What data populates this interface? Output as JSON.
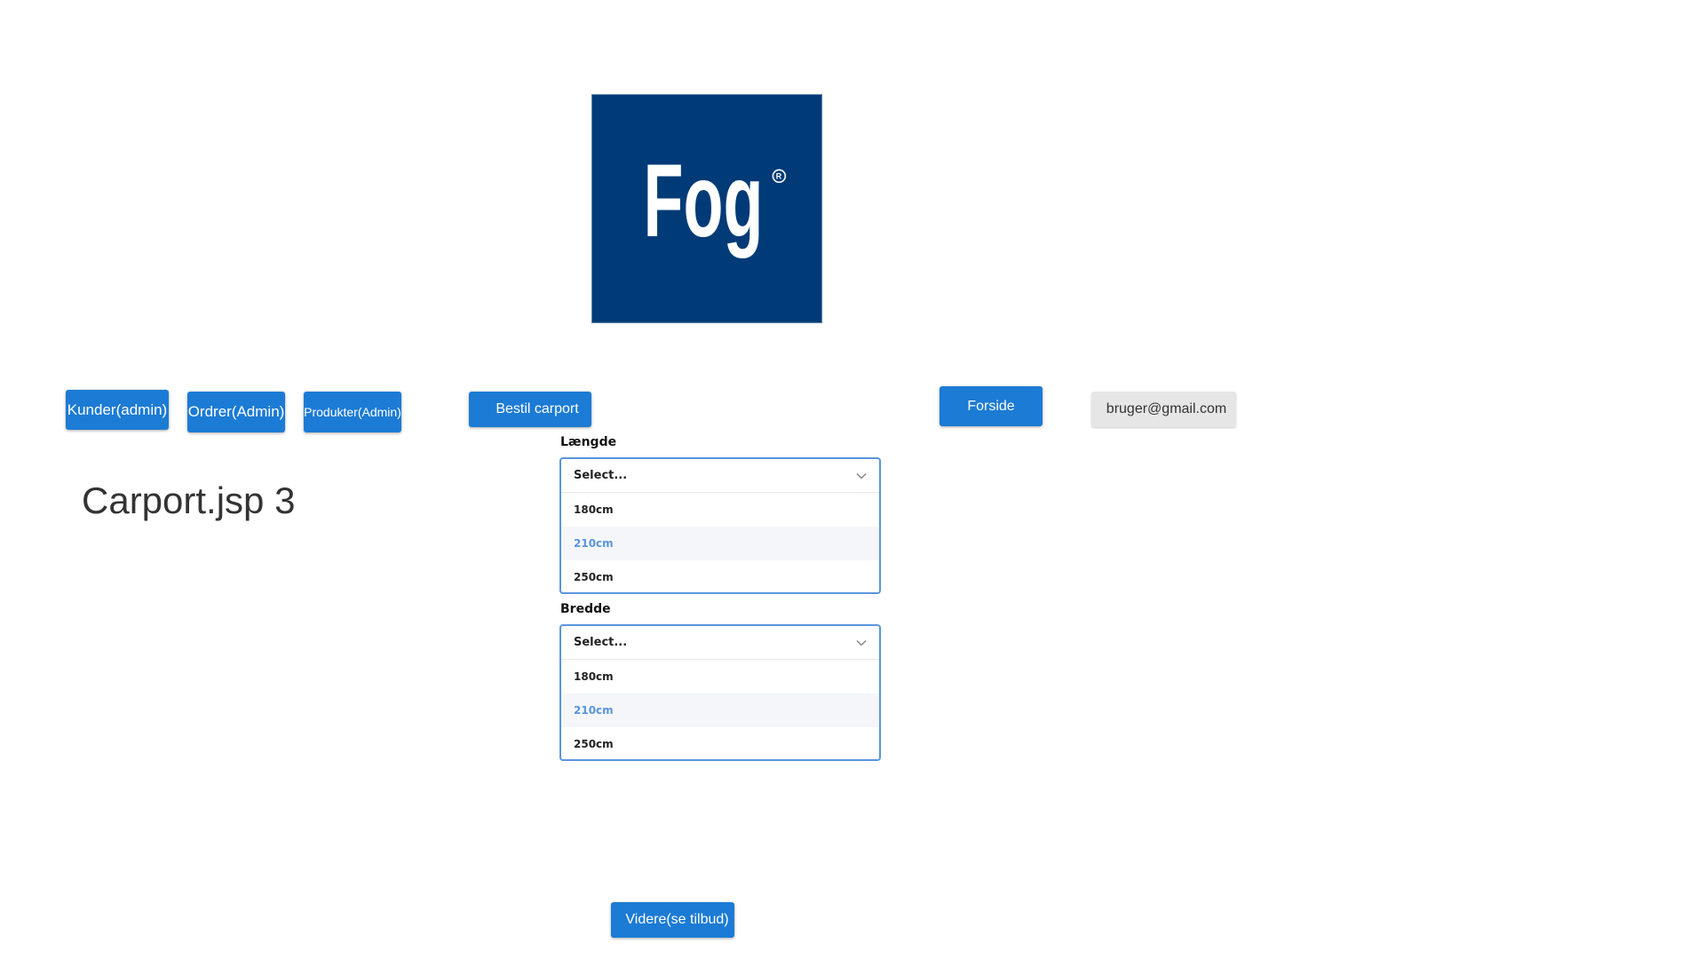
{
  "logo": {
    "text": "Fog",
    "mark": "®",
    "bg_color": "#003b77"
  },
  "nav": {
    "kunder_label": "Kunder(admin)",
    "ordrer_label": "Ordrer(Admin)",
    "produkter_label": "Produkter(Admin)",
    "bestil_label": "Bestil carport",
    "forside_label": "Forside",
    "user_email": "bruger@gmail.com"
  },
  "page": {
    "heading": "Carport.jsp 3"
  },
  "form": {
    "length": {
      "label": "Længde",
      "placeholder": "Select...",
      "options": [
        "180cm",
        "210cm",
        "250cm"
      ],
      "highlighted": "210cm"
    },
    "width": {
      "label": "Bredde",
      "placeholder": "Select...",
      "options": [
        "180cm",
        "210cm",
        "250cm"
      ],
      "highlighted": "210cm"
    },
    "submit_label": "Videre(se tilbud)"
  },
  "colors": {
    "primary_button": "#1c7bd4",
    "select_border": "#5b95dd",
    "logo_bg": "#003b77"
  }
}
